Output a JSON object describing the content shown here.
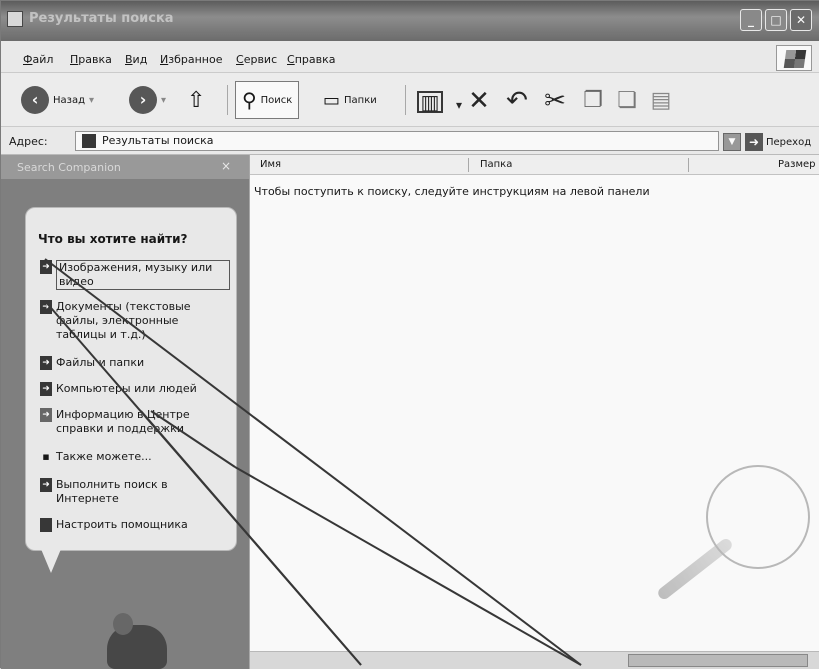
{
  "window": {
    "title": "Результаты поиска"
  },
  "menu": [
    "Файл",
    "Правка",
    "Вид",
    "Избранное",
    "Сервис",
    "Справка"
  ],
  "toolbar": {
    "back_label": "Назад",
    "search_label": "Поиск",
    "folders_label": "Папки"
  },
  "address": {
    "label": "Адрес:",
    "value": "Результаты поиска",
    "go_label": "Переход"
  },
  "companion": {
    "header": "Search Companion",
    "question": "Что вы хотите найти?",
    "options": [
      "Изображения, музыку или видео",
      "Документы (текстовые файлы, электронные таблицы и т.д.)",
      "Файлы и папки",
      "Компьютеры или людей",
      "Информацию в Центре справки и поддержки"
    ],
    "also_label": "Также можете...",
    "web_search": "Выполнить поиск в Интернете",
    "configure": "Настроить помощника"
  },
  "results": {
    "columns": [
      "Имя",
      "Папка",
      "Размер"
    ],
    "instruction": "Чтобы поступить к поиску, следуйте инструкциям на левой панели"
  },
  "colors": {
    "titlebar": "#7a7a7a",
    "pane_bg": "#7f7f7f",
    "bubble": "#eeeeee"
  }
}
